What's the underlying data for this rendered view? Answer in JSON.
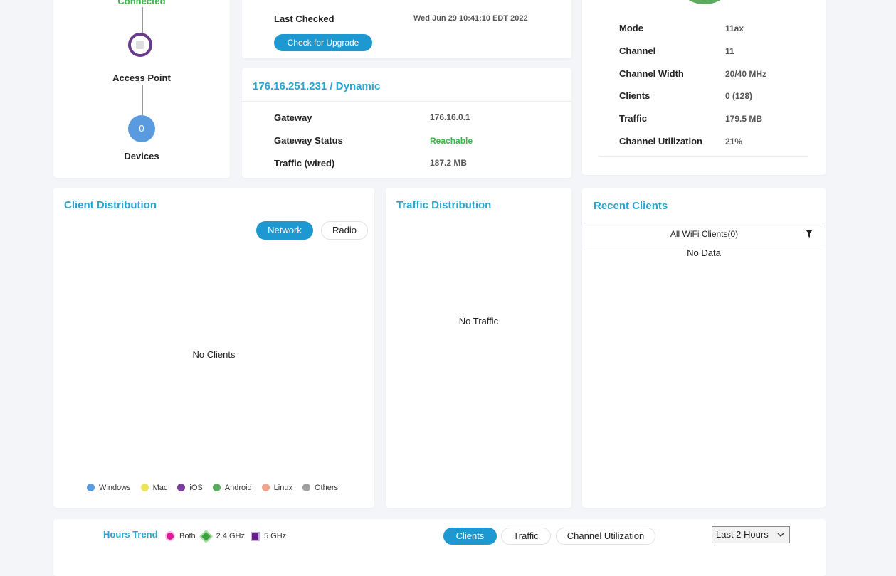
{
  "topology": {
    "connected_label": "Connected",
    "access_point_label": "Access Point",
    "devices_count": "0",
    "devices_label": "Devices"
  },
  "firmware": {
    "last_checked_label": "Last Checked",
    "last_checked_value": "Wed Jun 29 10:41:10 EDT 2022",
    "upgrade_button": "Check for Upgrade"
  },
  "wan": {
    "title": "176.16.251.231 / Dynamic",
    "rows": [
      {
        "label": "Gateway",
        "value": "176.16.0.1"
      },
      {
        "label": "Gateway Status",
        "value": "Reachable"
      },
      {
        "label": "Traffic (wired)",
        "value": "187.2 MB"
      }
    ]
  },
  "radio": {
    "rows": [
      {
        "label": "Mode",
        "value": "11ax"
      },
      {
        "label": "Channel",
        "value": "11"
      },
      {
        "label": "Channel Width",
        "value": "20/40 MHz"
      },
      {
        "label": "Clients",
        "value": "0 (128)"
      },
      {
        "label": "Traffic",
        "value": "179.5 MB"
      },
      {
        "label": "Channel Utilization",
        "value": "21%"
      }
    ]
  },
  "client_distribution": {
    "title": "Client Distribution",
    "tabs": [
      "Network",
      "Radio"
    ],
    "empty": "No Clients",
    "legend": [
      {
        "name": "Windows",
        "color": "#5a9be0"
      },
      {
        "name": "Mac",
        "color": "#ece35a"
      },
      {
        "name": "iOS",
        "color": "#7a3f9a"
      },
      {
        "name": "Android",
        "color": "#5aab5e"
      },
      {
        "name": "Linux",
        "color": "#f0a48c"
      },
      {
        "name": "Others",
        "color": "#a0a0a0"
      }
    ]
  },
  "traffic_distribution": {
    "title": "Traffic Distribution",
    "empty": "No Traffic"
  },
  "recent_clients": {
    "title": "Recent Clients",
    "filter_label": "All WiFi Clients(0)",
    "empty": "No Data"
  },
  "hours_trend": {
    "title": "Hours Trend",
    "bands": [
      {
        "name": "Both",
        "color": "#e0199a"
      },
      {
        "name": "2.4 GHz",
        "color": "#3aa43a"
      },
      {
        "name": "5 GHz",
        "color": "#6b1f8a"
      }
    ],
    "tabs": [
      "Clients",
      "Traffic",
      "Channel Utilization"
    ],
    "range_select": "Last 2 Hours"
  },
  "colors": {
    "accent": "#1e98d0",
    "title": "#2aa5cf",
    "status_ok": "#3cb54a",
    "ap_ring": "#6a3a8c",
    "devices_circle": "#5a9be0"
  }
}
